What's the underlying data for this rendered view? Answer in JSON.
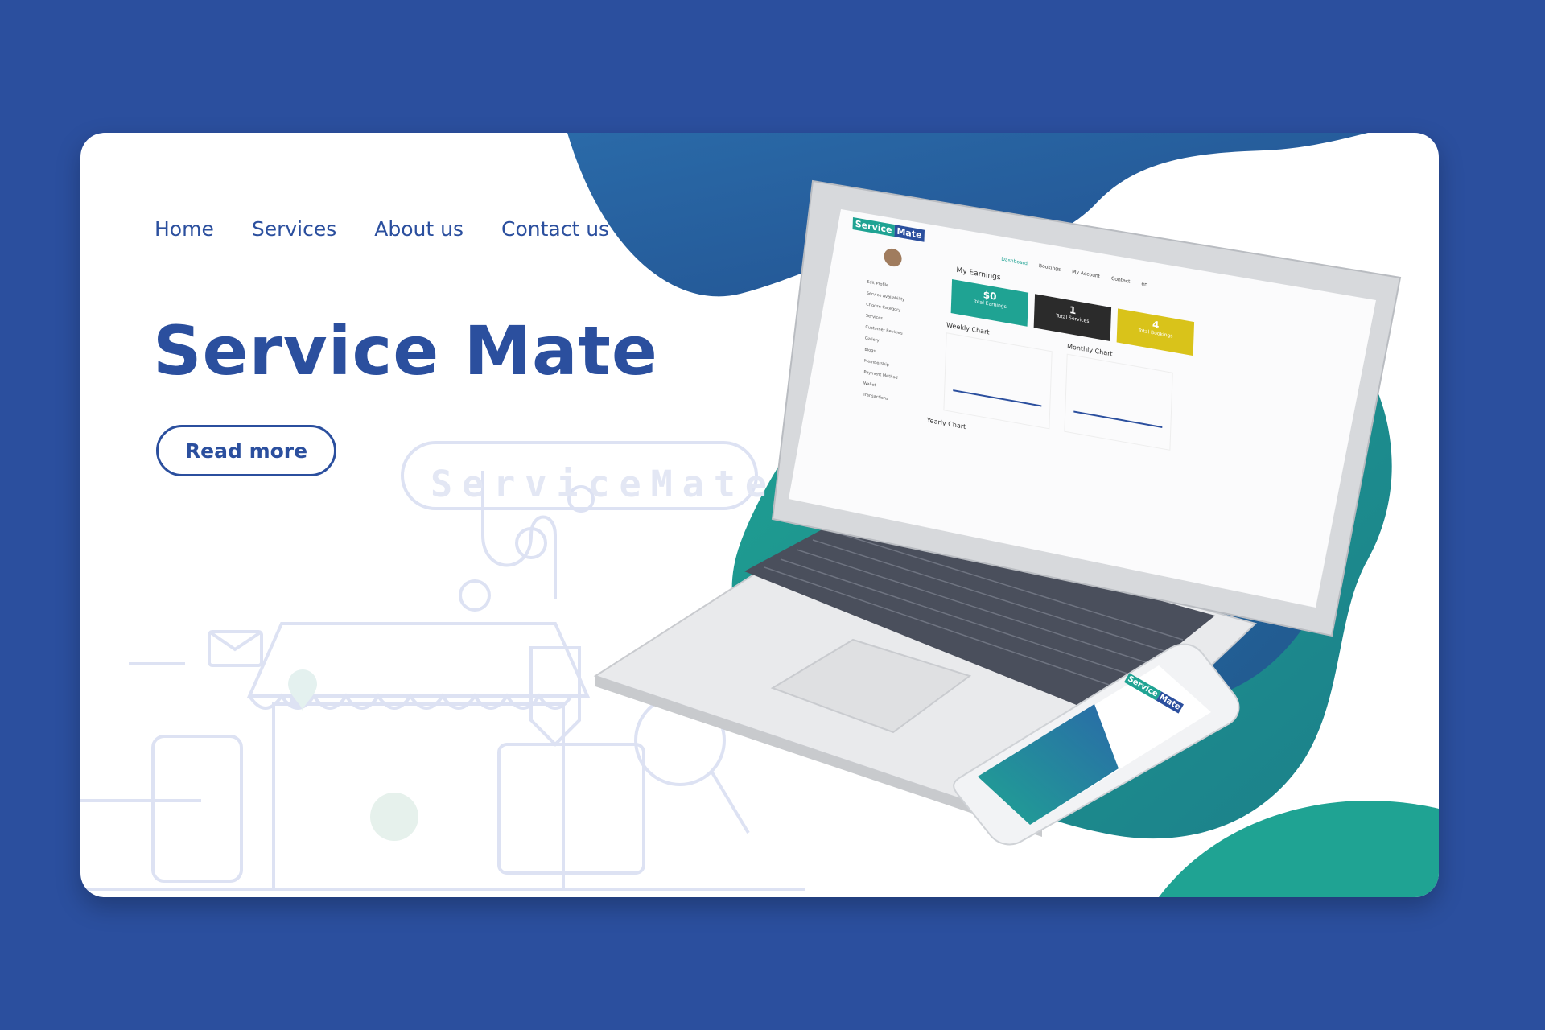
{
  "nav": {
    "items": [
      {
        "label": "Home"
      },
      {
        "label": "Services"
      },
      {
        "label": "About us"
      },
      {
        "label": "Contact us"
      }
    ]
  },
  "hero": {
    "title": "Service Mate",
    "cta_label": "Read more",
    "watermark": "ServiceMate"
  },
  "dashboard": {
    "brand_left": "Service",
    "brand_right": "Mate",
    "tabs": [
      "Dashboard",
      "Bookings",
      "My Account",
      "Contact",
      "en"
    ],
    "section_title": "My Earnings",
    "stats": [
      {
        "value": "$0",
        "label": "Total Earnings",
        "color": "#1fa393"
      },
      {
        "value": "1",
        "label": "Total Services",
        "color": "#2b2b2b"
      },
      {
        "value": "4",
        "label": "Total Bookings",
        "color": "#d9c31a"
      }
    ],
    "weekly_title": "Weekly Chart",
    "monthly_title": "Monthly Chart",
    "yearly_title": "Yearly Chart",
    "sidebar": [
      "Edit Profile",
      "Service Availability",
      "Choose Category",
      "Services",
      "Customer Reviews",
      "Gallery",
      "Blogs",
      "Membership",
      "Payment Method",
      "Wallet",
      "Transactions"
    ]
  },
  "phone": {
    "brand_left": "Service",
    "brand_right": "Mate"
  },
  "colors": {
    "background": "#2b4f9e",
    "accent_blue": "#2b4f9e",
    "teal": "#1fa393",
    "card": "#ffffff"
  }
}
